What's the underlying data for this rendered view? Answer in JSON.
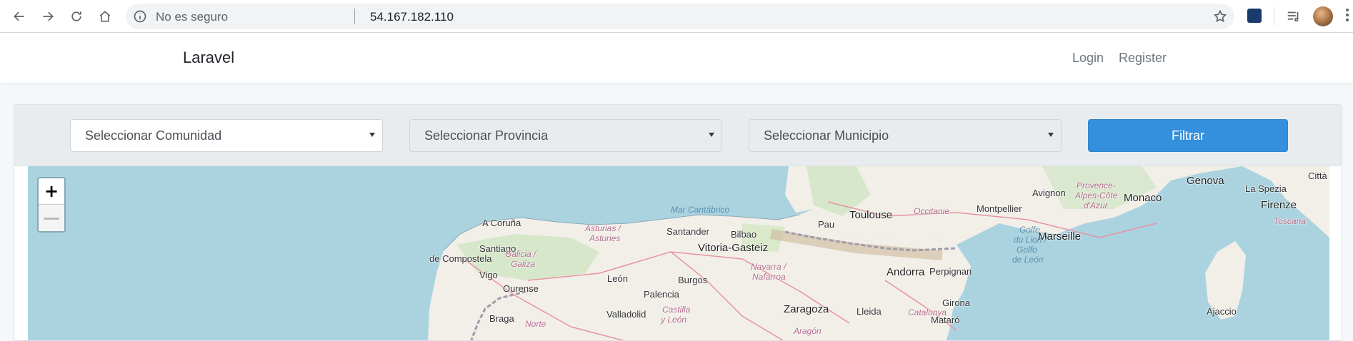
{
  "browser": {
    "security_label": "No es seguro",
    "url": "54.167.182.110"
  },
  "navbar": {
    "brand": "Laravel",
    "login": "Login",
    "register": "Register"
  },
  "filters": {
    "comunidad": "Seleccionar Comunidad",
    "provincia": "Seleccionar Provincia",
    "municipio": "Seleccionar Municipio",
    "button": "Filtrar"
  },
  "map": {
    "zoom_in": "+",
    "zoom_out": "—",
    "places": {
      "coruna": "A Coruña",
      "santiago": "Santiago",
      "compostela": "de Compostela",
      "vigo": "Vigo",
      "ourense": "Ourense",
      "braga": "Braga",
      "galicia": "Galicia /",
      "galiza": "Galiza",
      "asturias1": "Asturias /",
      "asturias2": "Asturies",
      "leon": "León",
      "santander": "Santander",
      "bilbao": "Bilbao",
      "vitoria": "Vitoria-Gasteiz",
      "burgos": "Burgos",
      "palencia": "Palencia",
      "valladolid": "Valladolid",
      "castilla1": "Castilla",
      "castilla2": "y León",
      "norte": "Norte",
      "navarra1": "Navarra /",
      "navarra2": "Nafarroa",
      "zaragoza": "Zaragoza",
      "aragon": "Aragón",
      "lleida": "Lleida",
      "catalunya": "Catalunya",
      "girona": "Girona",
      "mataro": "Mataró",
      "andorra": "Andorra",
      "perpignan": "Perpignan",
      "pau": "Pau",
      "toulouse": "Toulouse",
      "occitanie": "Occitanie",
      "montpellier": "Montpellier",
      "avignon": "Avignon",
      "marseille": "Marseille",
      "provence1": "Provence-",
      "provence2": "Alpes-Côte",
      "provence3": "d'Azur",
      "monaco": "Monaco",
      "genova": "Genova",
      "laspezia": "La Spezia",
      "firenze": "Firenze",
      "toscana": "Toscana",
      "citta": "Città",
      "ajaccio": "Ajaccio",
      "marcantabrico": "Mar Cantábrico",
      "golfe1": "Golfe",
      "golfe2": "du Lion /",
      "golfe3": "Golfo",
      "golfe4": "de León"
    }
  }
}
